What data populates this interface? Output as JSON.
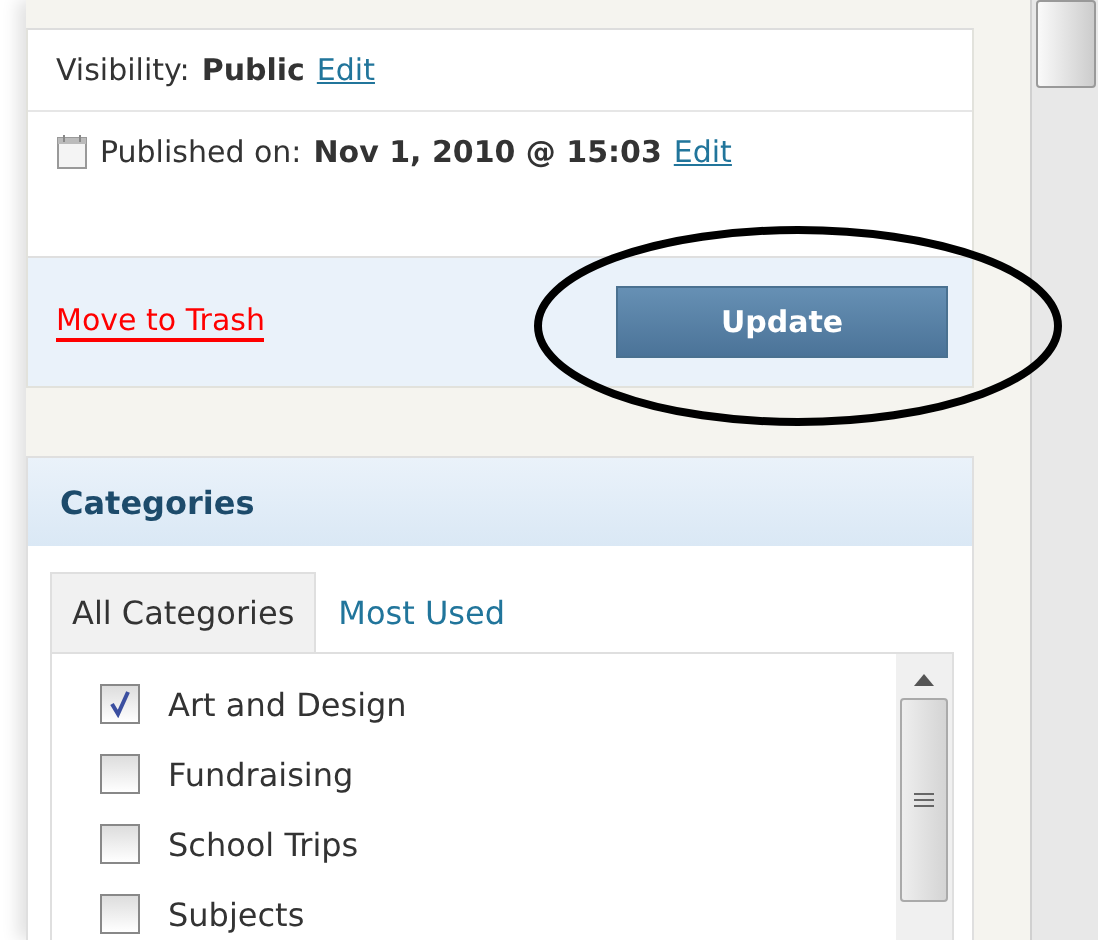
{
  "publish": {
    "visibility_label": "Visibility:",
    "visibility_value": "Public",
    "visibility_edit": "Edit",
    "published_label": "Published on:",
    "published_value": "Nov 1, 2010 @ 15:03",
    "published_edit": "Edit",
    "trash_link": "Move to Trash",
    "update_button": "Update"
  },
  "categories": {
    "title": "Categories",
    "tabs": [
      {
        "label": "All Categories",
        "selected": true
      },
      {
        "label": "Most Used",
        "selected": false
      }
    ],
    "items": [
      {
        "label": "Art and Design",
        "checked": true
      },
      {
        "label": "Fundraising",
        "checked": false
      },
      {
        "label": "School Trips",
        "checked": false
      },
      {
        "label": "Subjects",
        "checked": false
      }
    ]
  }
}
